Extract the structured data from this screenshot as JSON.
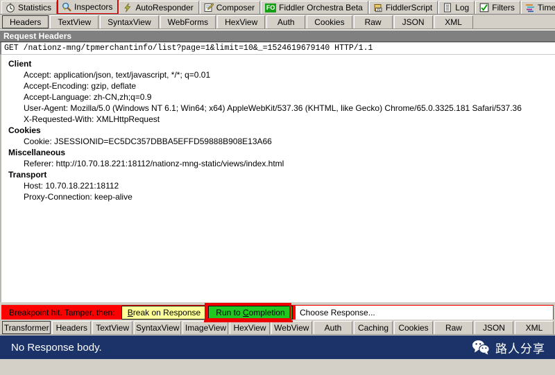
{
  "top_tabs": [
    {
      "label": "Statistics",
      "icon": "stopwatch-icon",
      "selected": false,
      "highlighted": false
    },
    {
      "label": "Inspectors",
      "icon": "magnifier-icon",
      "selected": true,
      "highlighted": true
    },
    {
      "label": "AutoResponder",
      "icon": "lightning-icon",
      "selected": false,
      "highlighted": false
    },
    {
      "label": "Composer",
      "icon": "pencil-note-icon",
      "selected": false,
      "highlighted": false
    },
    {
      "label": "Fiddler Orchestra Beta",
      "icon": "fo-badge-icon",
      "selected": false,
      "highlighted": false
    },
    {
      "label": "FiddlerScript",
      "icon": "js-scroll-icon",
      "selected": false,
      "highlighted": false
    },
    {
      "label": "Log",
      "icon": "log-page-icon",
      "selected": false,
      "highlighted": false
    },
    {
      "label": "Filters",
      "icon": "checkbox-green-icon",
      "selected": false,
      "highlighted": false
    },
    {
      "label": "Timeline",
      "icon": "timeline-bars-icon",
      "selected": false,
      "highlighted": false
    }
  ],
  "request_tabs": [
    {
      "label": "Headers",
      "selected": true
    },
    {
      "label": "TextView",
      "selected": false
    },
    {
      "label": "SyntaxView",
      "selected": false
    },
    {
      "label": "WebForms",
      "selected": false
    },
    {
      "label": "HexView",
      "selected": false
    },
    {
      "label": "Auth",
      "selected": false
    },
    {
      "label": "Cookies",
      "selected": false
    },
    {
      "label": "Raw",
      "selected": false
    },
    {
      "label": "JSON",
      "selected": false
    },
    {
      "label": "XML",
      "selected": false
    }
  ],
  "request": {
    "panel_title": "Request Headers",
    "request_line": "GET /nationz-mng/tpmerchantinfo/list?page=1&limit=10&_=1524619679140 HTTP/1.1",
    "groups": [
      {
        "name": "Client",
        "items": [
          "Accept: application/json, text/javascript, */*; q=0.01",
          "Accept-Encoding: gzip, deflate",
          "Accept-Language: zh-CN,zh;q=0.9",
          "User-Agent: Mozilla/5.0 (Windows NT 6.1; Win64; x64) AppleWebKit/537.36 (KHTML, like Gecko) Chrome/65.0.3325.181 Safari/537.36",
          "X-Requested-With: XMLHttpRequest"
        ]
      },
      {
        "name": "Cookies",
        "items": [
          "Cookie: JSESSIONID=EC5DC357DBBA5EFFD59888B908E13A66"
        ]
      },
      {
        "name": "Miscellaneous",
        "items": [
          "Referer: http://10.70.18.221:18112/nationz-mng-static/views/index.html"
        ]
      },
      {
        "name": "Transport",
        "items": [
          "Host: 10.70.18.221:18112",
          "Proxy-Connection: keep-alive"
        ]
      }
    ]
  },
  "breakpoint": {
    "message": "Breakpoint hit. Tamper, then:",
    "break_on_response_label": "Break on Response",
    "break_on_response_accel": "B",
    "run_to_completion_label": "Run to Completion",
    "run_to_completion_accel": "C",
    "choose_response_value": "Choose Response...",
    "bar_color": "#ff0000",
    "yellow_button_color": "#ffff99",
    "green_button_color": "#22c822",
    "highlight_color": "#ee0000"
  },
  "response_tabs": [
    {
      "label": "Transformer",
      "selected": true
    },
    {
      "label": "Headers",
      "selected": false
    },
    {
      "label": "TextView",
      "selected": false
    },
    {
      "label": "SyntaxView",
      "selected": false
    },
    {
      "label": "ImageView",
      "selected": false
    },
    {
      "label": "HexView",
      "selected": false
    },
    {
      "label": "WebView",
      "selected": false
    },
    {
      "label": "Auth",
      "selected": false
    },
    {
      "label": "Caching",
      "selected": false
    },
    {
      "label": "Cookies",
      "selected": false
    },
    {
      "label": "Raw",
      "selected": false
    },
    {
      "label": "JSON",
      "selected": false
    },
    {
      "label": "XML",
      "selected": false
    }
  ],
  "response": {
    "body_message": "No Response body.",
    "background_color": "#1b3368"
  },
  "watermark": {
    "icon": "wechat-icon",
    "text": "路人分享"
  }
}
